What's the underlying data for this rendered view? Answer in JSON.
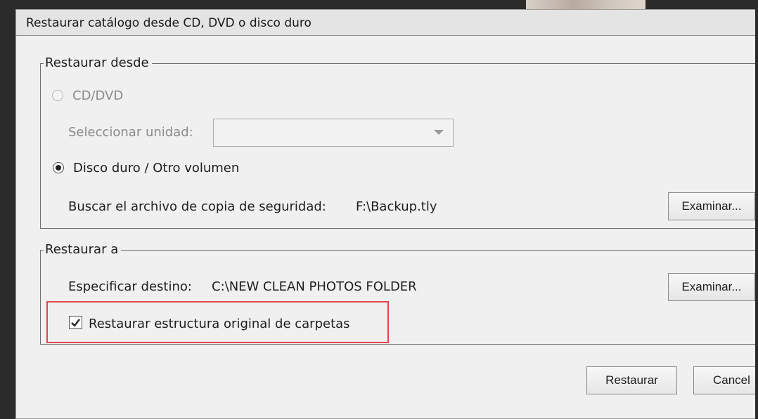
{
  "dialog": {
    "title": "Restaurar catálogo desde CD, DVD o disco duro"
  },
  "restore_from": {
    "legend": "Restaurar desde",
    "cd_dvd_label": "CD/DVD",
    "select_drive_label": "Seleccionar unidad:",
    "select_drive_value": "",
    "hard_disk_label": "Disco duro / Otro volumen",
    "backup_file_label": "Buscar el archivo de copia de seguridad:",
    "backup_file_value": "F:\\Backup.tly",
    "browse_label": "Examinar..."
  },
  "restore_to": {
    "legend": "Restaurar a",
    "destination_label": "Especificar destino:",
    "destination_value": "C:\\NEW CLEAN PHOTOS FOLDER",
    "browse_label": "Examinar...",
    "keep_structure_label": "Restaurar estructura original de carpetas",
    "keep_structure_checked": true
  },
  "footer": {
    "restore_button": "Restaurar",
    "cancel_button": "Cancel"
  },
  "colors": {
    "highlight": "#e0474c"
  }
}
